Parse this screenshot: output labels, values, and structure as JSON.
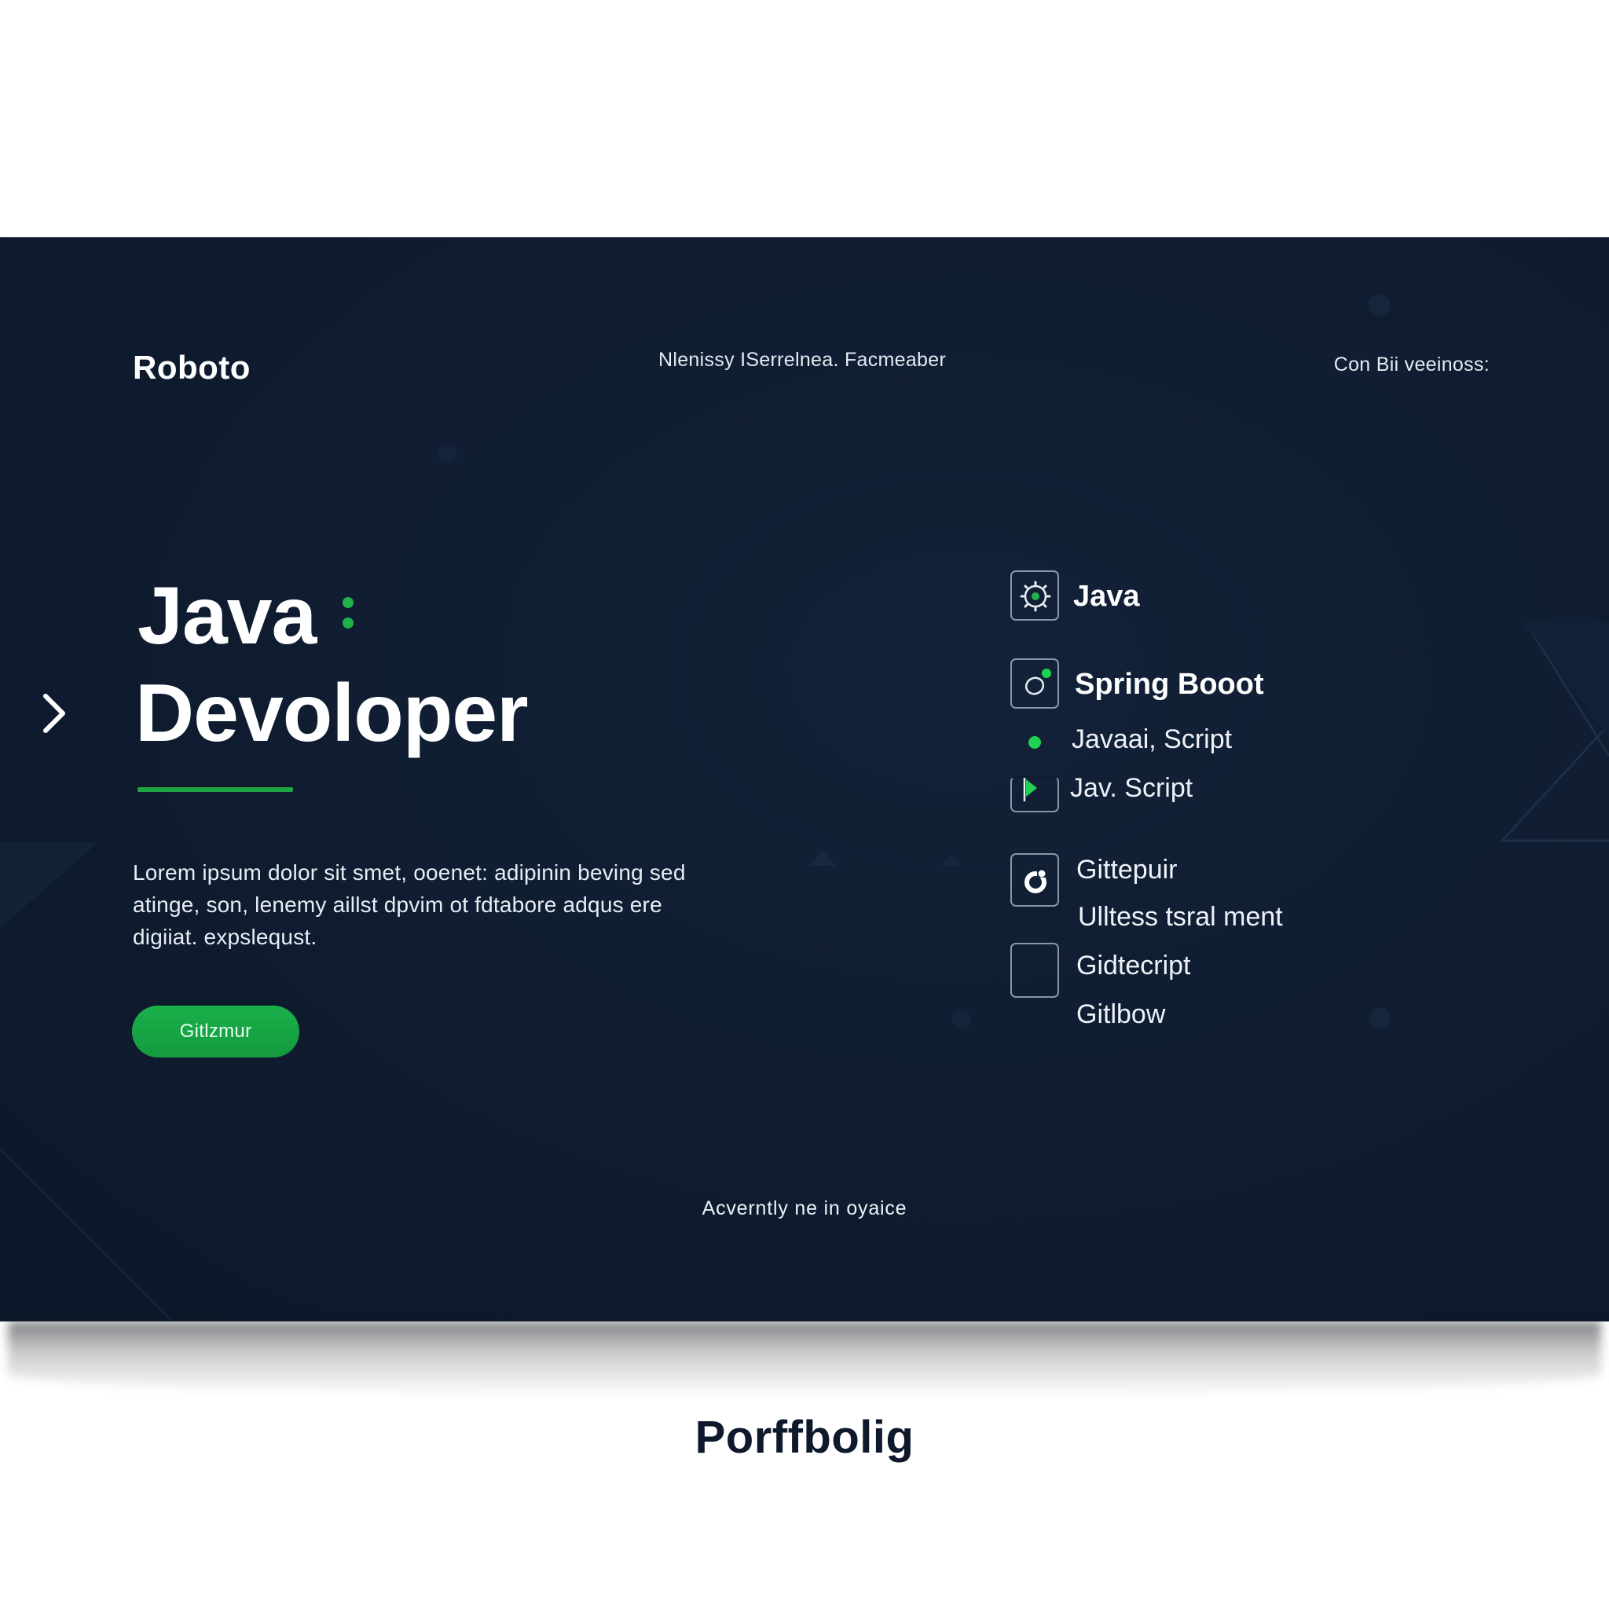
{
  "header": {
    "logo": "Roboto",
    "nav_center": "Nlenissy ISerrelnea. Facmeaber",
    "nav_right": "Con Bii veeinoss:"
  },
  "hero": {
    "title_line1": "Java",
    "title_line2": "Devoloper",
    "description": "Lorem ipsum dolor sit smet, ooenet: adipinin beving sed atinge, son, lenemy aillst dpvim ot fdtabore adqus ere digiiat. expslequst.",
    "cta_label": "Gitlzmur"
  },
  "skills": [
    {
      "label": "Java",
      "icon": "gear-icon"
    },
    {
      "label": "Spring Booot",
      "icon": "spring-icon"
    },
    {
      "label": "Javaai, Script",
      "icon": "dot-bullet-icon"
    },
    {
      "label": "Jav. Script",
      "icon": "play-icon"
    },
    {
      "label": "Gittepuir",
      "icon": "github-icon"
    },
    {
      "label": "Ulltess tsral ment",
      "icon": ""
    },
    {
      "label": "Gidtecript",
      "icon": "empty-box-icon"
    },
    {
      "label": "Gitlbow",
      "icon": ""
    }
  ],
  "footer": {
    "note": "Acverntly ne in oyaice"
  },
  "caption": "Porffbolig",
  "colors": {
    "panel_bg": "#0f1c30",
    "accent_green": "#1fb24a",
    "text": "#ffffff",
    "caption_text": "#0e1a2c"
  }
}
